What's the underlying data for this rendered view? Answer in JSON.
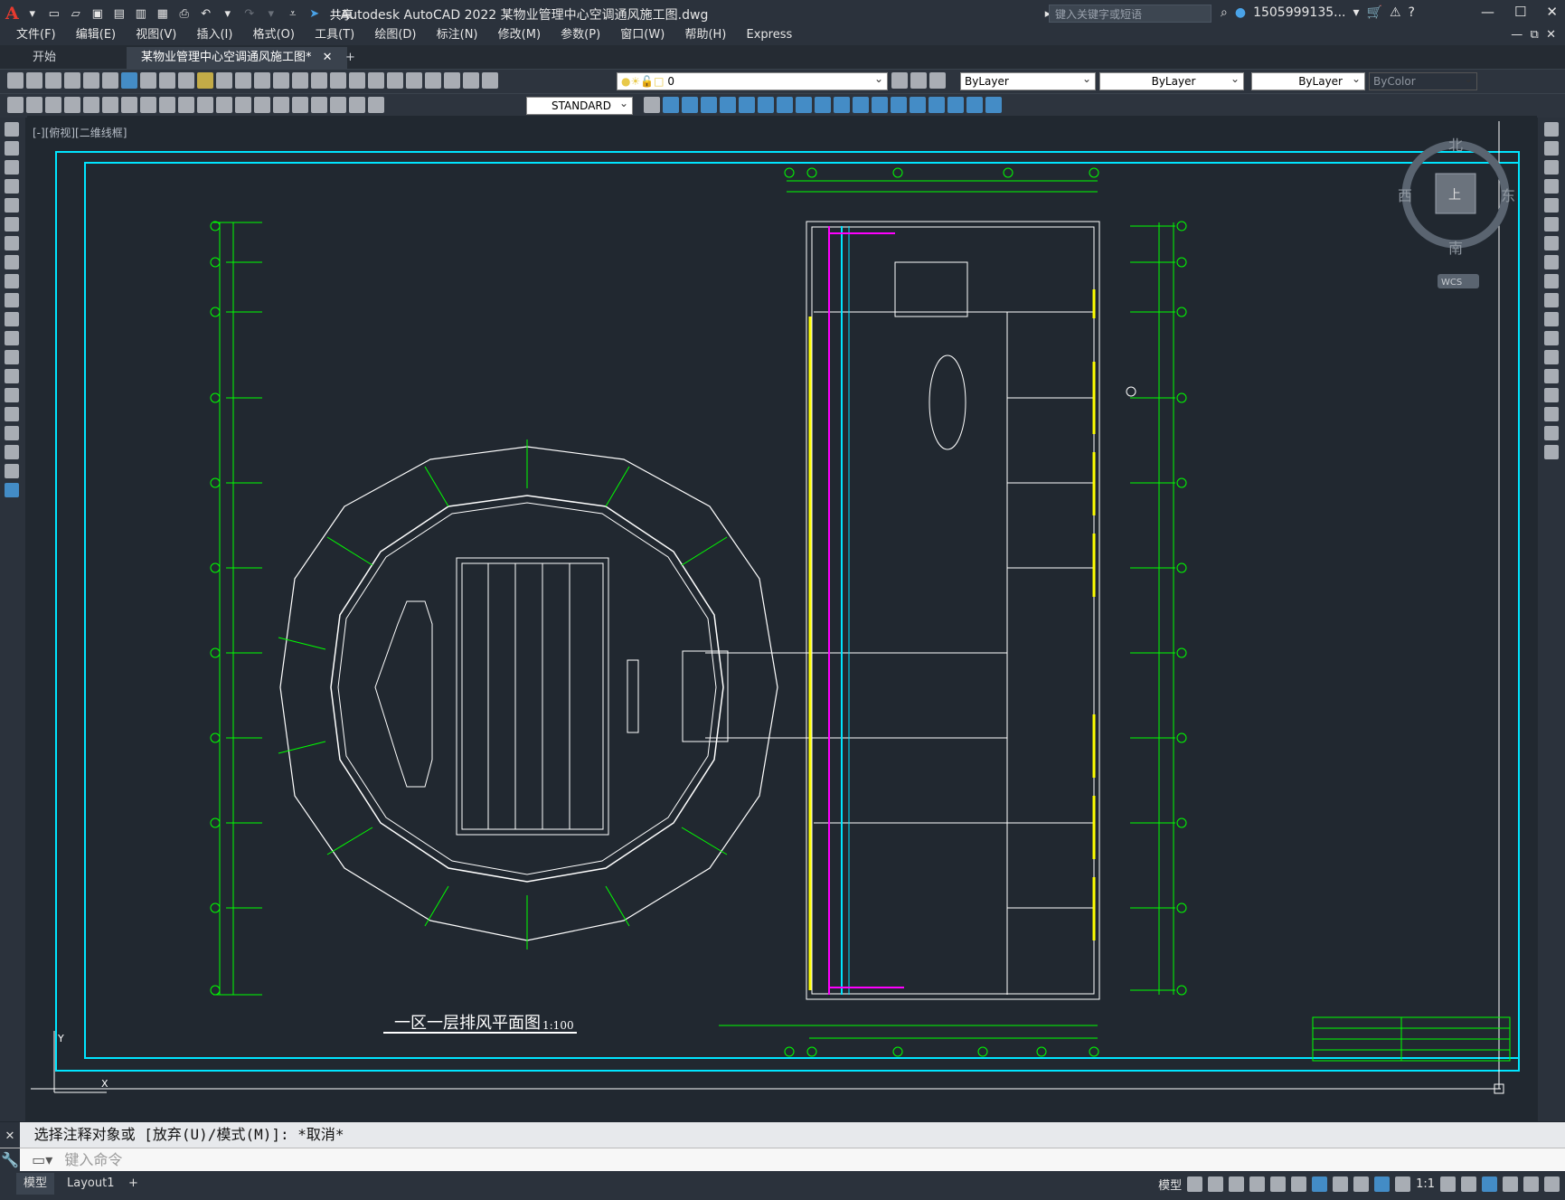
{
  "app": {
    "title": "Autodesk AutoCAD 2022 某物业管理中心空调通风施工图.dwg",
    "logo": "A",
    "share": "共享"
  },
  "search": {
    "placeholder": "键入关键字或短语"
  },
  "user": {
    "name": "1505999135..."
  },
  "menu": [
    "文件(F)",
    "编辑(E)",
    "视图(V)",
    "插入(I)",
    "格式(O)",
    "工具(T)",
    "绘图(D)",
    "标注(N)",
    "修改(M)",
    "参数(P)",
    "窗口(W)",
    "帮助(H)",
    "Express"
  ],
  "tabs": {
    "start": "开始",
    "file": "某物业管理中心空调通风施工图*"
  },
  "props": {
    "layer": "0",
    "color": "ByLayer",
    "linetype": "ByLayer",
    "lineweight": "ByLayer",
    "plotstyle": "ByColor",
    "textstyle": "STANDARD"
  },
  "viewport": {
    "label": "[-][俯视][二维线框]"
  },
  "viewcube": {
    "north": "北",
    "south": "南",
    "east": "东",
    "west": "西",
    "top": "上",
    "wcs": "WCS"
  },
  "drawing": {
    "title": "一区一层排风平面图",
    "scale": "1:100"
  },
  "command": {
    "history": "选择注释对象或 [放弃(U)/模式(M)]: *取消*",
    "placeholder": "键入命令"
  },
  "layouts": {
    "model": "模型",
    "layout1": "Layout1"
  },
  "status": {
    "model": "模型",
    "scale": "1:1"
  },
  "colors": {
    "accent": "#00e5ff",
    "grid_green": "#00ff00",
    "magenta": "#ff00ff",
    "yellow": "#ffff00"
  }
}
